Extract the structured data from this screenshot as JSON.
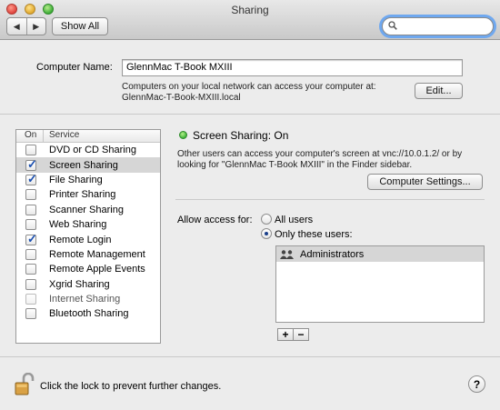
{
  "window": {
    "title": "Sharing"
  },
  "toolbar": {
    "show_all_label": "Show All",
    "back_glyph": "◀",
    "forward_glyph": "▶"
  },
  "computer": {
    "name_label": "Computer Name:",
    "name_value": "GlennMac T-Book MXIII",
    "info_line1": "Computers on your local network can access your computer at:",
    "info_line2": "GlennMac-T-Book-MXIII.local",
    "edit_label": "Edit..."
  },
  "services": {
    "header_on": "On",
    "header_service": "Service",
    "items": [
      {
        "label": "DVD or CD Sharing",
        "on": false
      },
      {
        "label": "Screen Sharing",
        "on": true,
        "selected": true
      },
      {
        "label": "File Sharing",
        "on": true
      },
      {
        "label": "Printer Sharing",
        "on": false
      },
      {
        "label": "Scanner Sharing",
        "on": false
      },
      {
        "label": "Web Sharing",
        "on": false
      },
      {
        "label": "Remote Login",
        "on": true
      },
      {
        "label": "Remote Management",
        "on": false
      },
      {
        "label": "Remote Apple Events",
        "on": false
      },
      {
        "label": "Xgrid Sharing",
        "on": false
      },
      {
        "label": "Internet Sharing",
        "on": false,
        "disabled": true
      },
      {
        "label": "Bluetooth Sharing",
        "on": false
      }
    ]
  },
  "detail": {
    "status": "Screen Sharing: On",
    "status_color": "#3fb33a",
    "desc_line1": "Other users can access your computer's screen at vnc://10.0.1.2/ or by",
    "desc_line2": "looking for \"GlennMac T-Book MXIII\" in the Finder sidebar.",
    "settings_button": "Computer Settings...",
    "access_label": "Allow access for:",
    "option_all": "All users",
    "option_only": "Only these users:",
    "users": [
      "Administrators"
    ],
    "add_glyph": "+",
    "remove_glyph": "−"
  },
  "footer": {
    "lock_text": "Click the lock to prevent further changes.",
    "help_glyph": "?"
  }
}
